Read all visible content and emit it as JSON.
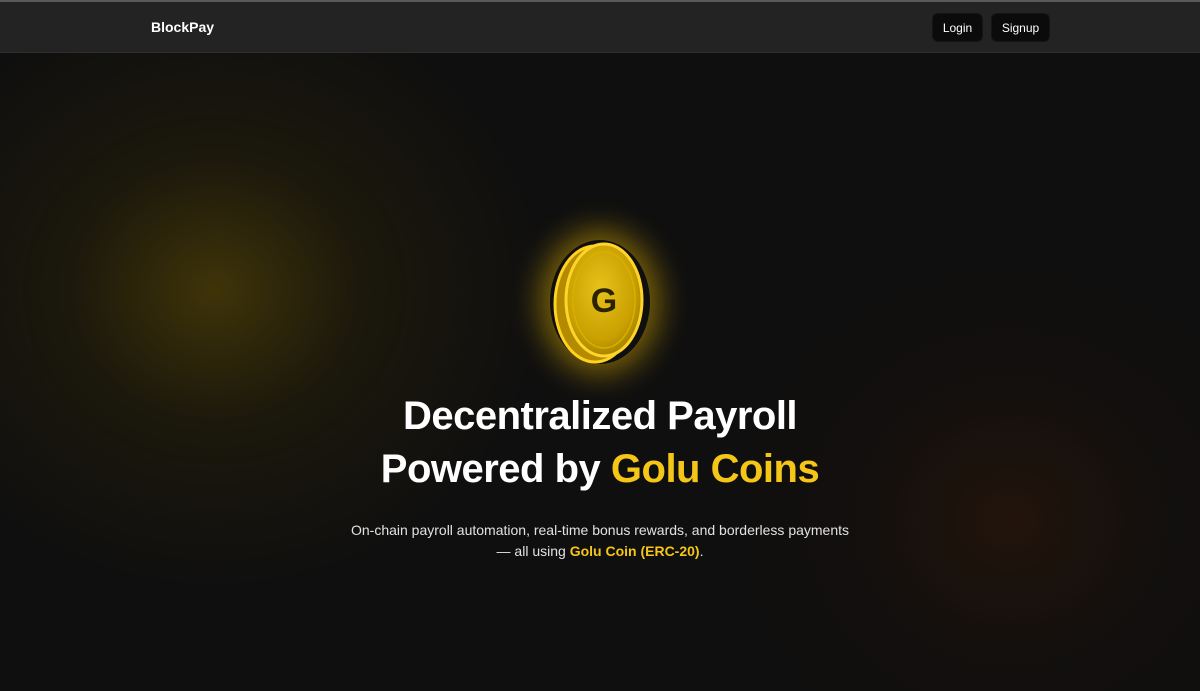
{
  "navbar": {
    "brand": "BlockPay",
    "login_label": "Login",
    "signup_label": "Signup"
  },
  "hero": {
    "coin_icon": "golu-coin-icon",
    "coin_letter": "G",
    "title_line1": "Decentralized Payroll",
    "title_line2_prefix": "Powered by ",
    "title_line2_accent": "Golu Coins",
    "subtitle_line1": "On-chain payroll automation, real-time bonus rewards, and borderless payments",
    "subtitle_line2_prefix": "— all using ",
    "subtitle_line2_accent": "Golu Coin (ERC-20)",
    "subtitle_line2_suffix": "."
  },
  "colors": {
    "accent": "#f5c518",
    "background": "#0f0f0f",
    "navbar": "#232323"
  }
}
